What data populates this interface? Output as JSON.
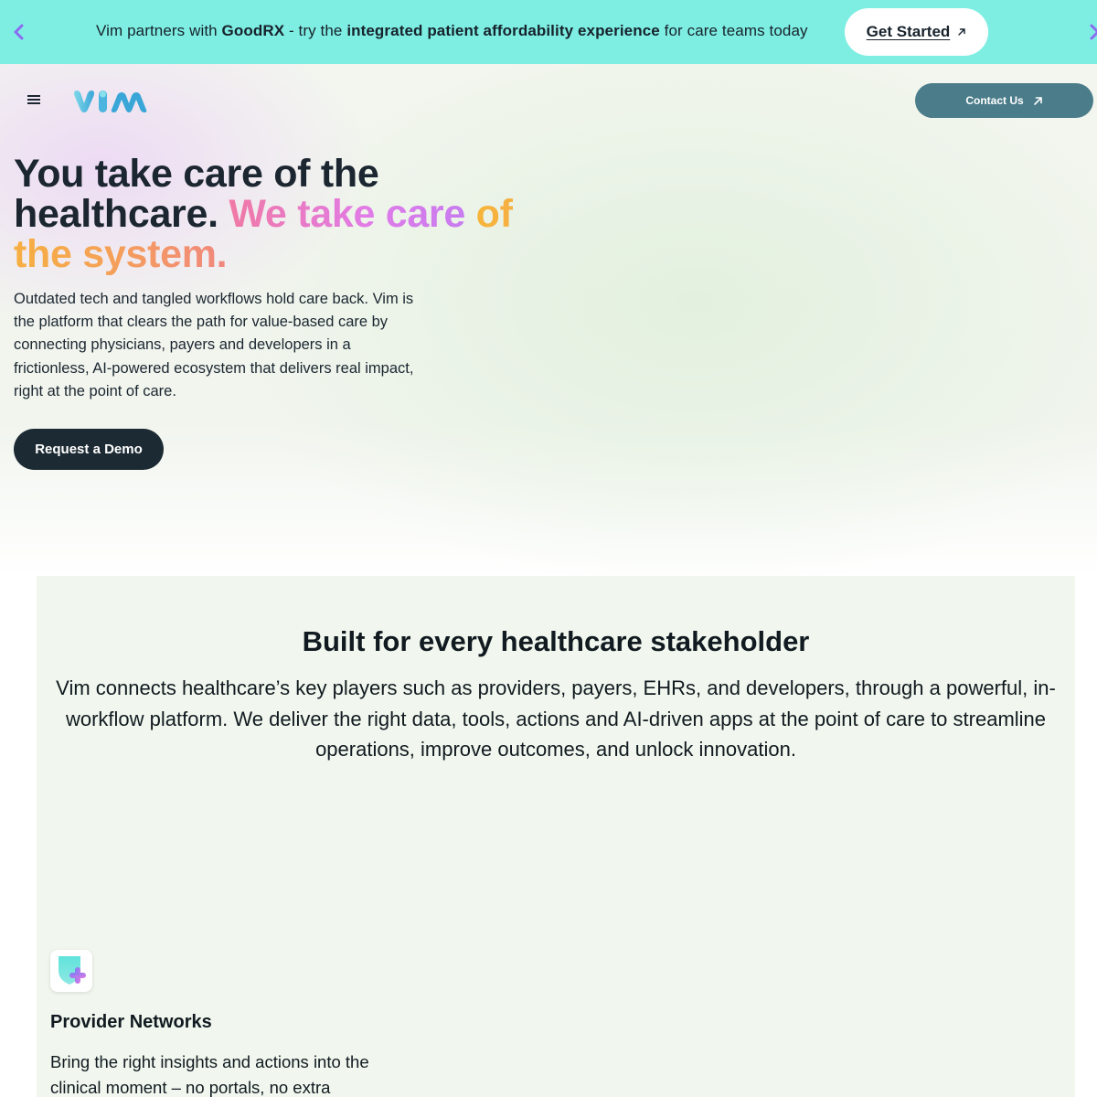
{
  "announcement": {
    "text_1": "Vim partners with ",
    "brand": "GoodRX",
    "text_2": " - try the ",
    "highlight": "integrated patient affordability experience",
    "text_3": " for care teams today",
    "cta_label": "Get Started",
    "prev_icon": "chevron-left-icon",
    "next_icon": "chevron-right-icon"
  },
  "header": {
    "menu_icon": "hamburger-menu-icon",
    "logo_text": "vim",
    "contact_label": "Contact Us"
  },
  "hero": {
    "headline_dark": "You take care of the healthcare.",
    "headline_pink": "We take care",
    "headline_orange": "of the system.",
    "description": "Outdated tech and tangled workflows hold care back. Vim is the platform that clears the path for value-based care by connecting physicians, payers and developers in a frictionless, AI-powered ecosystem that delivers real impact, right at the point of care.",
    "demo_label": "Request a Demo"
  },
  "stakeholders": {
    "title": "Built for every healthcare stakeholder",
    "lead": "Vim connects healthcare’s key players such as providers, payers, EHRs, and developers, through a powerful, in-workflow platform. We deliver the right data, tools, actions and AI-driven apps at the point of care to streamline operations, improve outcomes, and unlock innovation.",
    "card": {
      "icon": "shield-plus-icon",
      "title": "Provider Networks",
      "description": "Bring the right insights and actions into the clinical moment – no portals, no extra"
    }
  },
  "colors": {
    "announcement_bg": "#7eeee3",
    "contact_button_bg": "#4b7c8a",
    "demo_button_bg": "#1b2a33",
    "section_bg": "#f1f7ee",
    "gradient_pink": "#f07aa5",
    "gradient_violet": "#c77cf0",
    "gradient_orange": "#f5a256"
  }
}
